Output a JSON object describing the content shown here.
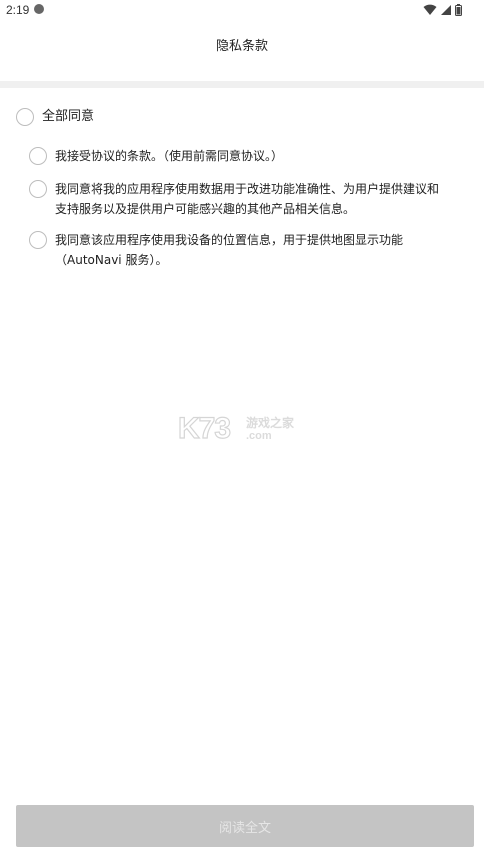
{
  "status_bar": {
    "time": "2:19",
    "icons": [
      "app-notification-icon",
      "wifi-icon",
      "signal-icon",
      "battery-icon"
    ]
  },
  "header": {
    "title": "隐私条款"
  },
  "consent": {
    "all_label": "全部同意",
    "options": [
      {
        "lines": [
          "我接受协议的条款。（使用前需同意协议。）"
        ],
        "checked": false
      },
      {
        "lines": [
          "我同意将我的应用程序使用数据用于改进功能准确性、为用户提供建议和",
          "支持服务以及提供用户可能感兴趣的其他产品相关信息。"
        ],
        "checked": false
      },
      {
        "lines": [
          "我同意该应用程序使用我设备的位置信息，用于提供地图显示功能",
          "（AutoNavi 服务）。"
        ],
        "checked": false
      }
    ]
  },
  "watermark": {
    "brand": "K73",
    "line1": "游戏之家",
    "line2": ".com"
  },
  "footer": {
    "read_full_label": "阅读全文",
    "enabled": false
  },
  "colors": {
    "background": "#ffffff",
    "divider": "#f0f0f0",
    "radio_border": "#bdbdbd",
    "button_disabled_bg": "#c4c4c4",
    "button_disabled_text": "#e6e6e6"
  }
}
